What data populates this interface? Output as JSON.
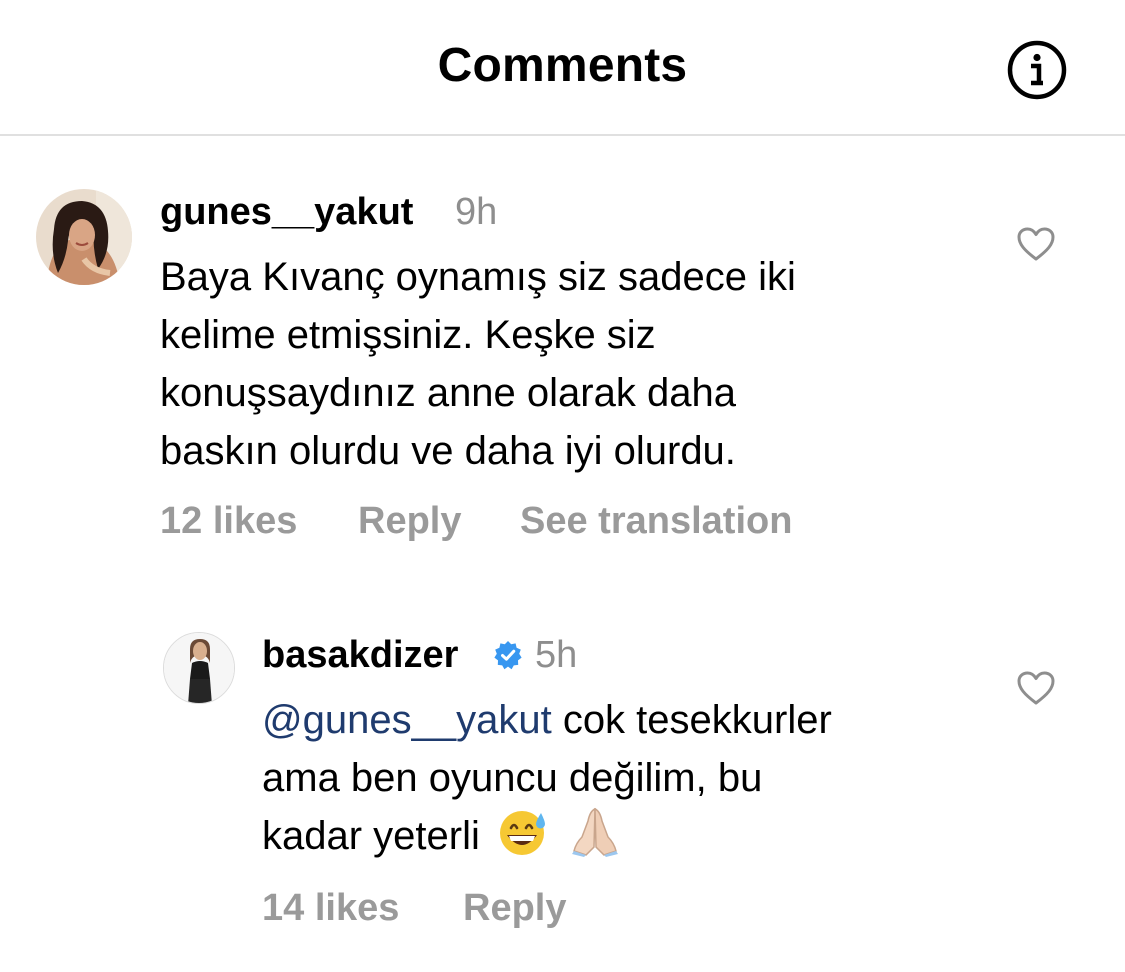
{
  "header": {
    "title": "Comments",
    "info_icon": "info-circle-icon"
  },
  "comments": [
    {
      "username": "gunes__yakut",
      "time": "9h",
      "text_lines": [
        "Baya Kıvanç oynamış siz sadece iki",
        "kelime etmişsiniz. Keşke siz",
        "konuşsaydınız anne olarak daha",
        "baskın olurdu ve daha iyi olurdu."
      ],
      "likes": "12 likes",
      "reply_label": "Reply",
      "translate_label": "See translation",
      "heart_icon": "heart-outline-icon"
    },
    {
      "username": "basakdizer",
      "verified": true,
      "time": "5h",
      "mention": "@gunes__yakut",
      "text_lines": [
        "cok tesekkurler",
        "ama ben oyuncu değilim, bu",
        "kadar yeterli"
      ],
      "emojis": [
        "grinning-sweat-emoji",
        "folded-hands-emoji"
      ],
      "likes": "14 likes",
      "reply_label": "Reply",
      "heart_icon": "heart-outline-icon"
    }
  ],
  "colors": {
    "meta_gray": "#9a9a9a",
    "time_gray": "#8e8e8e",
    "mention": "#1f3b6e",
    "verified_blue": "#3897f0",
    "divider": "#e0e0e0"
  }
}
